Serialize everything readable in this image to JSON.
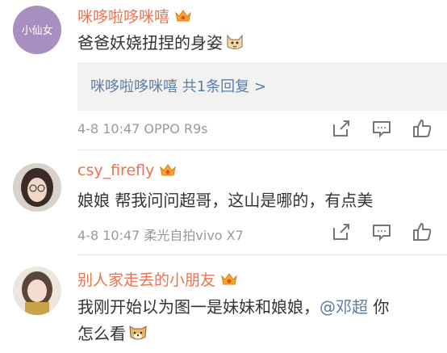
{
  "comments": [
    {
      "username": "咪哆啦哆咪嘻",
      "avatar_text": "小仙女",
      "text": "爸爸妖娆扭捏的身姿",
      "emoji": "cat-face-icon",
      "reply": {
        "author": "咪哆啦哆咪嘻",
        "summary": "共1条回复 >"
      },
      "meta": "4-8 10:47 OPPO R9s"
    },
    {
      "username": "csy_firefly",
      "text": "娘娘 帮我问问超哥，这山是哪的，有点美",
      "meta": "4-8 10:47 柔光自拍vivo X7"
    },
    {
      "username": "别人家走丢的小朋友",
      "text_line1": "我刚开始以为图一是妹妹和娘娘，",
      "mention": "@邓超",
      "text_line1_end": " 你",
      "text_line2": "怎么看",
      "emoji": "doge-icon"
    }
  ],
  "colors": {
    "username": "#eb7350",
    "link": "#5b7da6",
    "meta": "#999999",
    "reply_bg": "#f2f2f2"
  }
}
